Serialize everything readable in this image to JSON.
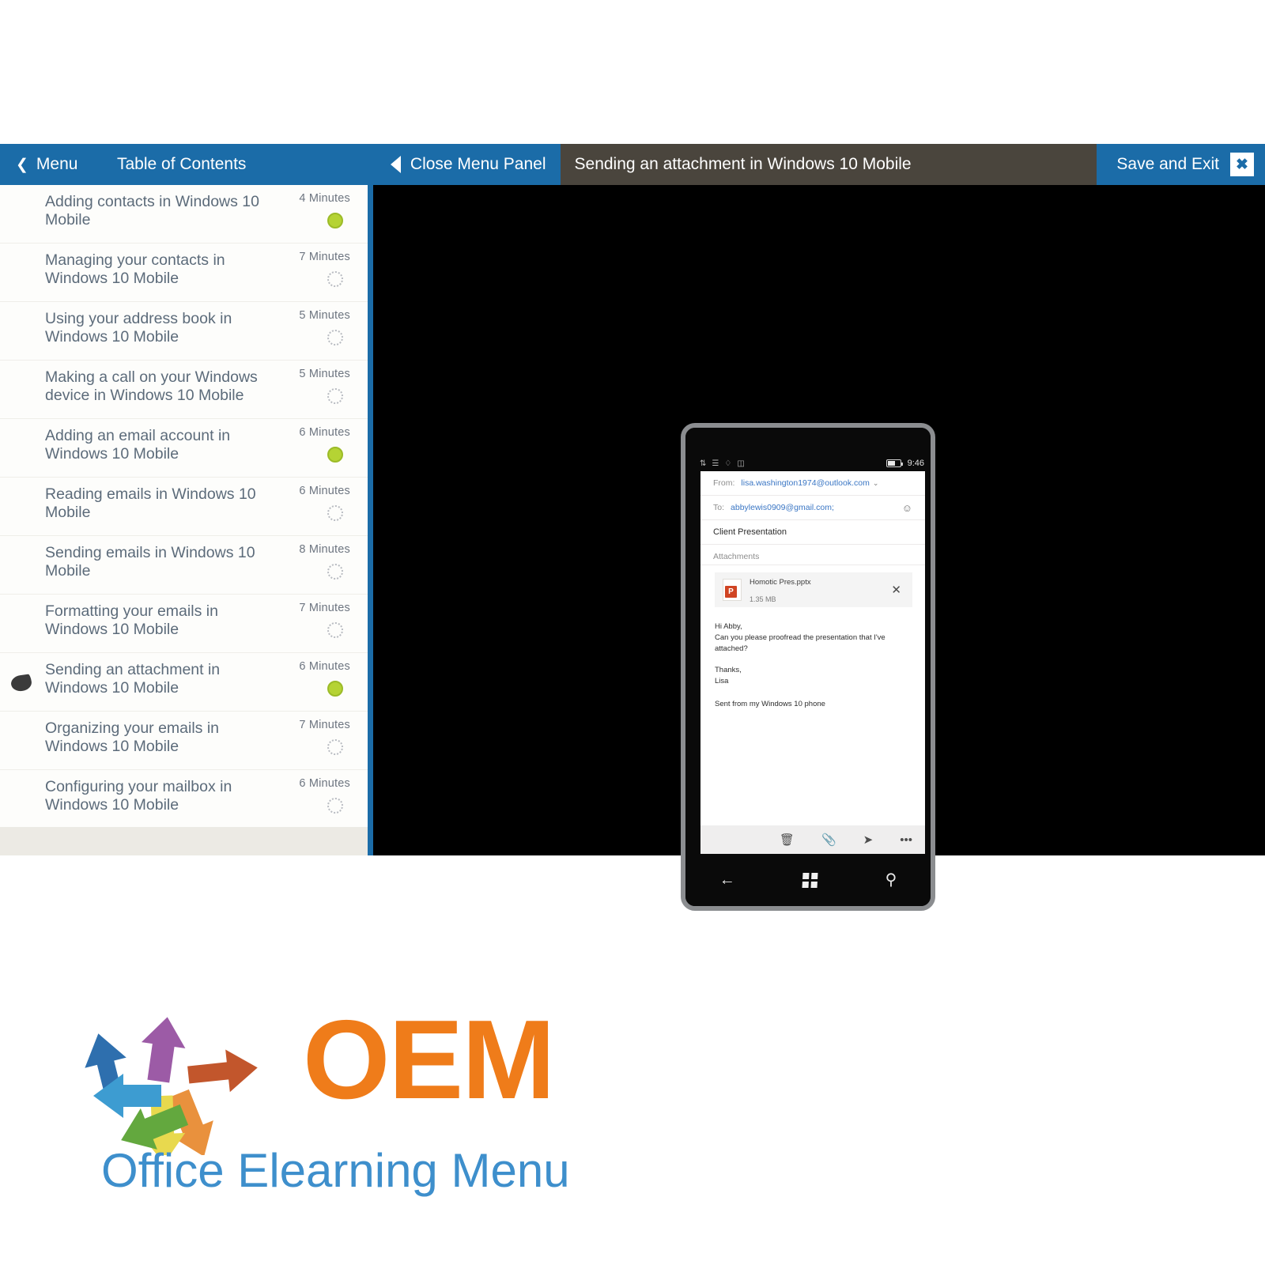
{
  "topbar": {
    "menu_label": "Menu",
    "menu_chevron": "chevron-left-icon",
    "toc_label": "Table of Contents",
    "close_panel_label": "Close Menu Panel",
    "lesson_title": "Sending an attachment in Windows 10 Mobile",
    "save_exit_label": "Save and Exit",
    "close_label": "✖"
  },
  "toc": {
    "items": [
      {
        "label": "Adding contacts in Windows 10 Mobile",
        "minutes": "4 Minutes",
        "status": "done",
        "current": false
      },
      {
        "label": "Managing your contacts in Windows 10 Mobile",
        "minutes": "7 Minutes",
        "status": "pending",
        "current": false
      },
      {
        "label": "Using your address book in Windows 10 Mobile",
        "minutes": "5 Minutes",
        "status": "pending",
        "current": false
      },
      {
        "label": "Making a call on your Windows device in Windows 10 Mobile",
        "minutes": "5 Minutes",
        "status": "pending",
        "current": false
      },
      {
        "label": "Adding an email account in Windows 10 Mobile",
        "minutes": "6 Minutes",
        "status": "done",
        "current": false
      },
      {
        "label": "Reading emails in Windows 10 Mobile",
        "minutes": "6 Minutes",
        "status": "pending",
        "current": false
      },
      {
        "label": "Sending emails in Windows 10 Mobile",
        "minutes": "8 Minutes",
        "status": "pending",
        "current": false
      },
      {
        "label": "Formatting your emails in Windows 10 Mobile",
        "minutes": "7 Minutes",
        "status": "pending",
        "current": false
      },
      {
        "label": "Sending an attachment in Windows 10 Mobile",
        "minutes": "6 Minutes",
        "status": "done",
        "current": true
      },
      {
        "label": "Organizing your emails in Windows 10 Mobile",
        "minutes": "7 Minutes",
        "status": "pending",
        "current": false
      },
      {
        "label": "Configuring your mailbox in Windows 10 Mobile",
        "minutes": "6 Minutes",
        "status": "pending",
        "current": false
      }
    ]
  },
  "phone": {
    "status": {
      "time": "9:46",
      "battery": "battery-icon"
    },
    "mail": {
      "from_label": "From:",
      "from_value": "lisa.washington1974@outlook.com",
      "from_caret": "⌄",
      "to_label": "To:",
      "to_value": "abbylewis0909@gmail.com;",
      "people_icon": "add-contact-icon",
      "subject": "Client Presentation",
      "attachments_label": "Attachments",
      "attachment": {
        "name": "Homotic Pres.pptx",
        "size": "1.35 MB",
        "remove": "✕",
        "icon": "powerpoint-file-icon"
      },
      "body": "Hi Abby,\nCan you please proofread the presentation that I've attached?\n\nThanks,\nLisa",
      "signature": "Sent from my Windows 10 phone"
    },
    "toolbar": {
      "delete": "🗑",
      "attach": "📎",
      "send": "➤",
      "more": "•••"
    },
    "nav": {
      "back": "←",
      "start": "windows-logo-icon",
      "search": "🔍"
    }
  },
  "branding": {
    "name": "OEM",
    "tagline": "Office Elearning Menu",
    "accent_orange": "#ef7c1a",
    "accent_blue": "#3e8fcc",
    "arrow_colors": [
      "#2e6fae",
      "#9c5ba6",
      "#c2562c",
      "#e9913d",
      "#e8d94e",
      "#63a83e",
      "#3d9cd1"
    ]
  },
  "colors": {
    "topbar_blue": "#1b6ca8",
    "title_brown": "#4a453d",
    "stage_black": "#000000",
    "dot_green": "#b5d334"
  }
}
